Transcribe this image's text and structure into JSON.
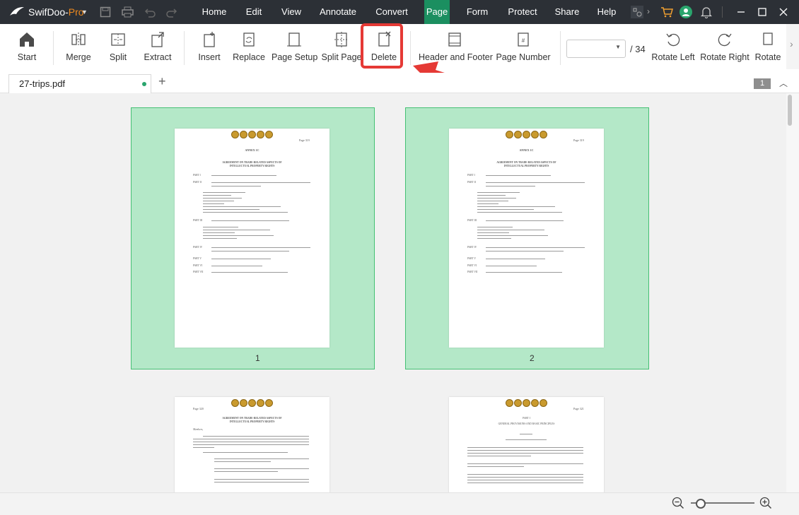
{
  "app": {
    "brand_prefix": "SwifDoo-",
    "brand_suffix": "Pro"
  },
  "menu": [
    "Home",
    "Edit",
    "View",
    "Annotate",
    "Convert",
    "Page",
    "Form",
    "Protect",
    "Share",
    "Help"
  ],
  "active_menu": "Page",
  "ribbon": {
    "start": "Start",
    "merge": "Merge",
    "split": "Split",
    "extract": "Extract",
    "insert": "Insert",
    "replace": "Replace",
    "page_setup": "Page Setup",
    "split_page": "Split Page",
    "delete": "Delete",
    "header_footer": "Header and Footer",
    "page_number": "Page Number",
    "page_total": "/ 34",
    "rotate_left": "Rotate Left",
    "rotate_right": "Rotate Right",
    "rotate": "Rotate"
  },
  "tabs": {
    "file_name": "27-trips.pdf",
    "add": "+",
    "page_indicator": "1"
  },
  "pages": {
    "p1_label": "1",
    "p2_label": "2",
    "annex": "ANNEX 1C",
    "title_line1": "AGREEMENT ON TRADE-RELATED ASPECTS OF",
    "title_line2": "INTELLECTUAL PROPERTY RIGHTS",
    "page_ref_1": "Page 319",
    "page_ref_2": "Page 319",
    "page_ref_3": "Page 320",
    "page_ref_4": "Page 321",
    "part1_head": "PART I",
    "part1_title": "GENERAL PROVISIONS AND BASIC PRINCIPLES",
    "part_i": "PART I",
    "part_ii": "PART II",
    "part_iii": "PART III",
    "part_iv": "PART IV",
    "part_v": "PART V",
    "part_vi": "PART VI",
    "part_vii": "PART VII",
    "members": "Members,"
  },
  "colors": {
    "accent": "#1b8f60",
    "highlight": "#e53935",
    "selection": "#b4e8c8"
  }
}
